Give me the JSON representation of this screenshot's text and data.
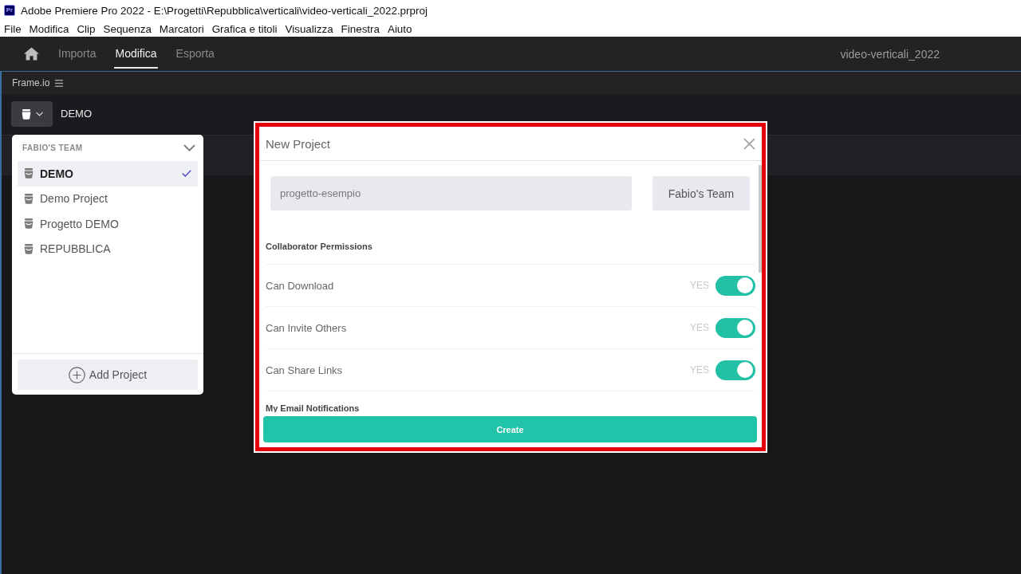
{
  "window": {
    "app_icon": "Pr",
    "title": "Adobe Premiere Pro 2022 - E:\\Progetti\\Repubblica\\verticali\\video-verticali_2022.prproj"
  },
  "menu": [
    "File",
    "Modifica",
    "Clip",
    "Sequenza",
    "Marcatori",
    "Grafica e titoli",
    "Visualizza",
    "Finestra",
    "Aiuto"
  ],
  "workspace_bar": {
    "tabs": [
      {
        "label": "Importa",
        "selected": false
      },
      {
        "label": "Modifica",
        "selected": true
      },
      {
        "label": "Esporta",
        "selected": false
      }
    ],
    "project_name": "video-verticali_2022"
  },
  "panel": {
    "title": "Frame.io",
    "current_project": "DEMO"
  },
  "project_menu": {
    "team": "FABIO'S TEAM",
    "projects": [
      {
        "name": "DEMO",
        "selected": true
      },
      {
        "name": "Demo Project",
        "selected": false
      },
      {
        "name": "Progetto DEMO",
        "selected": false
      },
      {
        "name": "REPUBBLICA",
        "selected": false
      }
    ],
    "add_button": "Add Project"
  },
  "dialog": {
    "title": "New Project",
    "project_name": "progetto-esempio",
    "team": "Fabio's Team",
    "permissions_heading": "Collaborator Permissions",
    "permissions": [
      {
        "label": "Can Download",
        "state_label": "YES",
        "on": true
      },
      {
        "label": "Can Invite Others",
        "state_label": "YES",
        "on": true
      },
      {
        "label": "Can Share Links",
        "state_label": "YES",
        "on": true
      }
    ],
    "notifications_heading": "My Email Notifications",
    "submit": "Create"
  }
}
